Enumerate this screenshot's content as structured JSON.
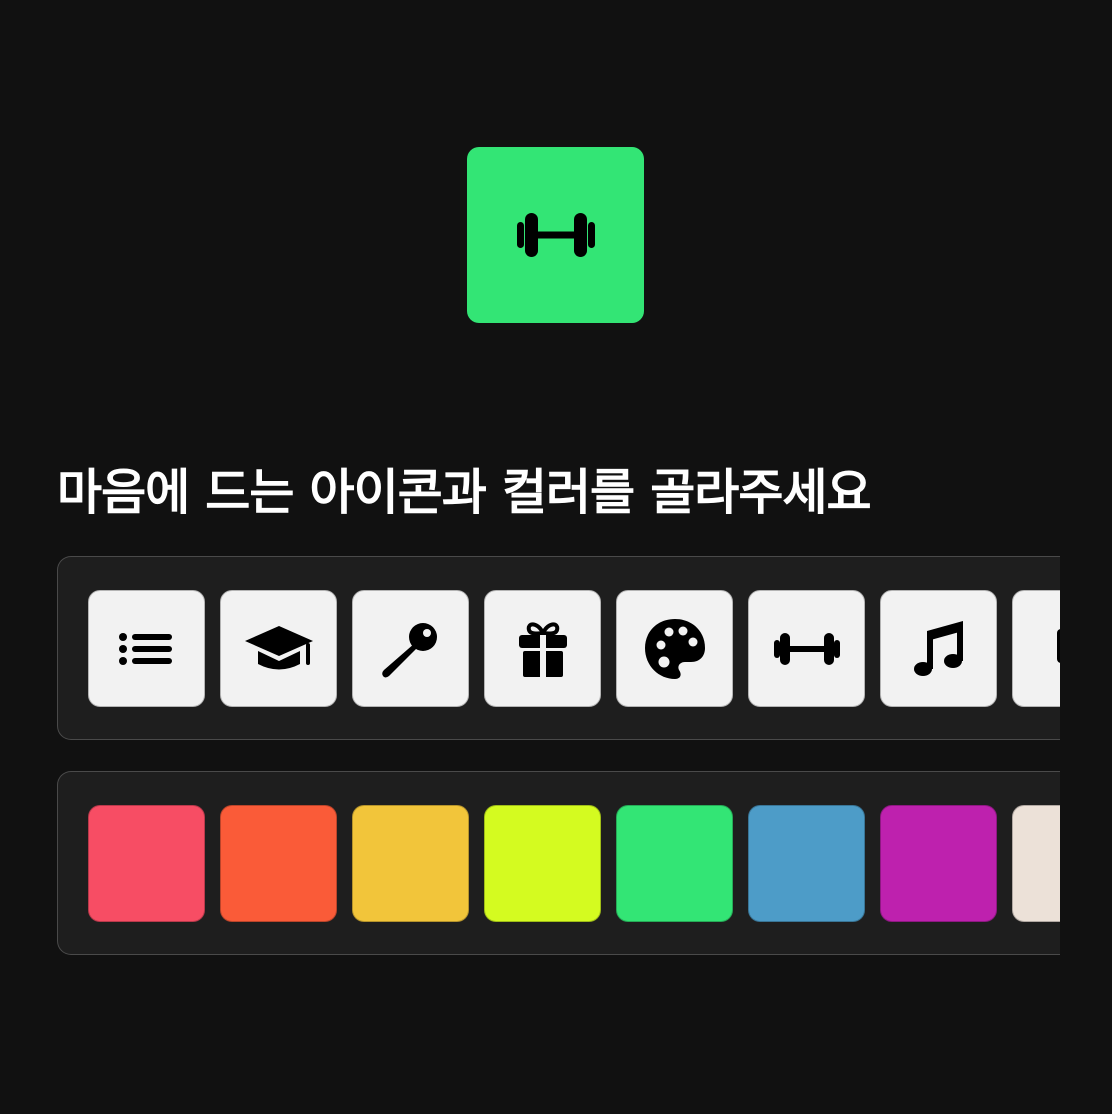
{
  "selected": {
    "icon": "dumbbell-icon",
    "color": "#33e575"
  },
  "heading": "마음에 드는 아이콘과 컬러를 골라주세요",
  "icons": [
    {
      "name": "list-icon"
    },
    {
      "name": "graduation-cap-icon"
    },
    {
      "name": "key-icon"
    },
    {
      "name": "gift-icon"
    },
    {
      "name": "palette-icon"
    },
    {
      "name": "dumbbell-icon"
    },
    {
      "name": "music-note-icon"
    },
    {
      "name": "desktop-icon"
    }
  ],
  "colors": [
    "#f74d64",
    "#fa5b38",
    "#f2c53a",
    "#d4fb20",
    "#33e575",
    "#4d9cc8",
    "#be21ae",
    "#ece1d8"
  ]
}
